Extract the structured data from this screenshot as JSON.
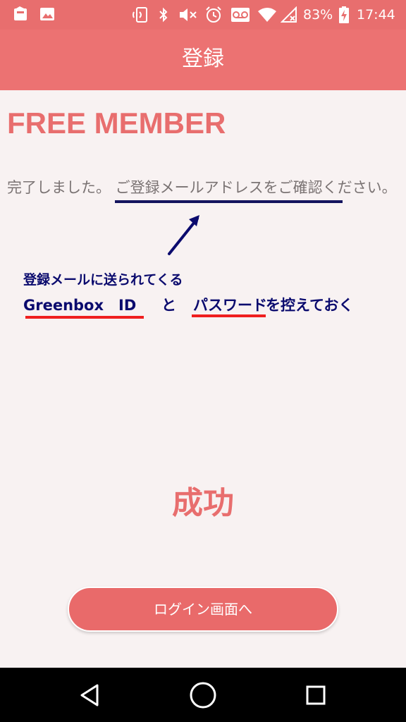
{
  "status_bar": {
    "battery": "83%",
    "time": "17:44",
    "icons": [
      "notification-app-icon",
      "gallery-icon",
      "nfc-icon",
      "bluetooth-icon",
      "mute-icon",
      "alarm-icon",
      "voicemail-icon",
      "wifi-icon",
      "battery-charging-icon"
    ]
  },
  "header": {
    "title": "登録"
  },
  "content": {
    "plan_title": "FREE MEMBER",
    "message": "完了しました。 ご登録メールアドレスをご確認ください。",
    "annotation": {
      "line1": "登録メールに送られてくる",
      "id_label": "Greenbox　ID",
      "connector": "と",
      "password_label": "パスワード",
      "suffix": "を控えておく"
    },
    "success": "成功",
    "login_button": "ログイン画面へ"
  },
  "nav_bar": {
    "buttons": [
      "back-icon",
      "home-icon",
      "recents-icon"
    ]
  },
  "colors": {
    "accent": "#e86e6e",
    "annotation_blue": "#0b0b6e",
    "annotation_red": "#ef1f1f",
    "background": "#f8f2f2"
  }
}
